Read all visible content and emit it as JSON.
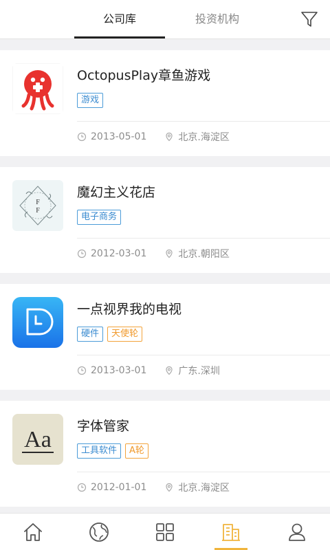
{
  "tabs": [
    {
      "label": "公司库",
      "active": true
    },
    {
      "label": "投资机构",
      "active": false
    }
  ],
  "companies": [
    {
      "name": "OctopusPlay章鱼游戏",
      "tags": [
        {
          "label": "游戏",
          "color": "blue"
        }
      ],
      "date": "2013-05-01",
      "location": "北京.海淀区",
      "logo": "octopus-logo"
    },
    {
      "name": "魔幻主义花店",
      "tags": [
        {
          "label": "电子商务",
          "color": "blue"
        }
      ],
      "date": "2012-03-01",
      "location": "北京.朝阳区",
      "logo": "flower-shop-logo"
    },
    {
      "name": "一点视界我的电视",
      "tags": [
        {
          "label": "硬件",
          "color": "blue"
        },
        {
          "label": "天使轮",
          "color": "orange"
        }
      ],
      "date": "2013-03-01",
      "location": "广东.深圳",
      "logo": "tv-logo"
    },
    {
      "name": "字体管家",
      "tags": [
        {
          "label": "工具软件",
          "color": "blue"
        },
        {
          "label": "A轮",
          "color": "orange"
        }
      ],
      "date": "2012-01-01",
      "location": "北京.海淀区",
      "logo": "font-logo"
    }
  ],
  "logo_text": {
    "flower": "F\nF",
    "font": "Aa"
  },
  "bottom_nav": [
    {
      "icon": "home-icon",
      "active": false
    },
    {
      "icon": "globe-icon",
      "active": false
    },
    {
      "icon": "grid-icon",
      "active": false
    },
    {
      "icon": "building-icon",
      "active": true
    },
    {
      "icon": "user-icon",
      "active": false
    }
  ],
  "colors": {
    "blue_tag": "#3a8bd0",
    "orange_tag": "#f0982a",
    "active_nav": "#f0b43c"
  }
}
